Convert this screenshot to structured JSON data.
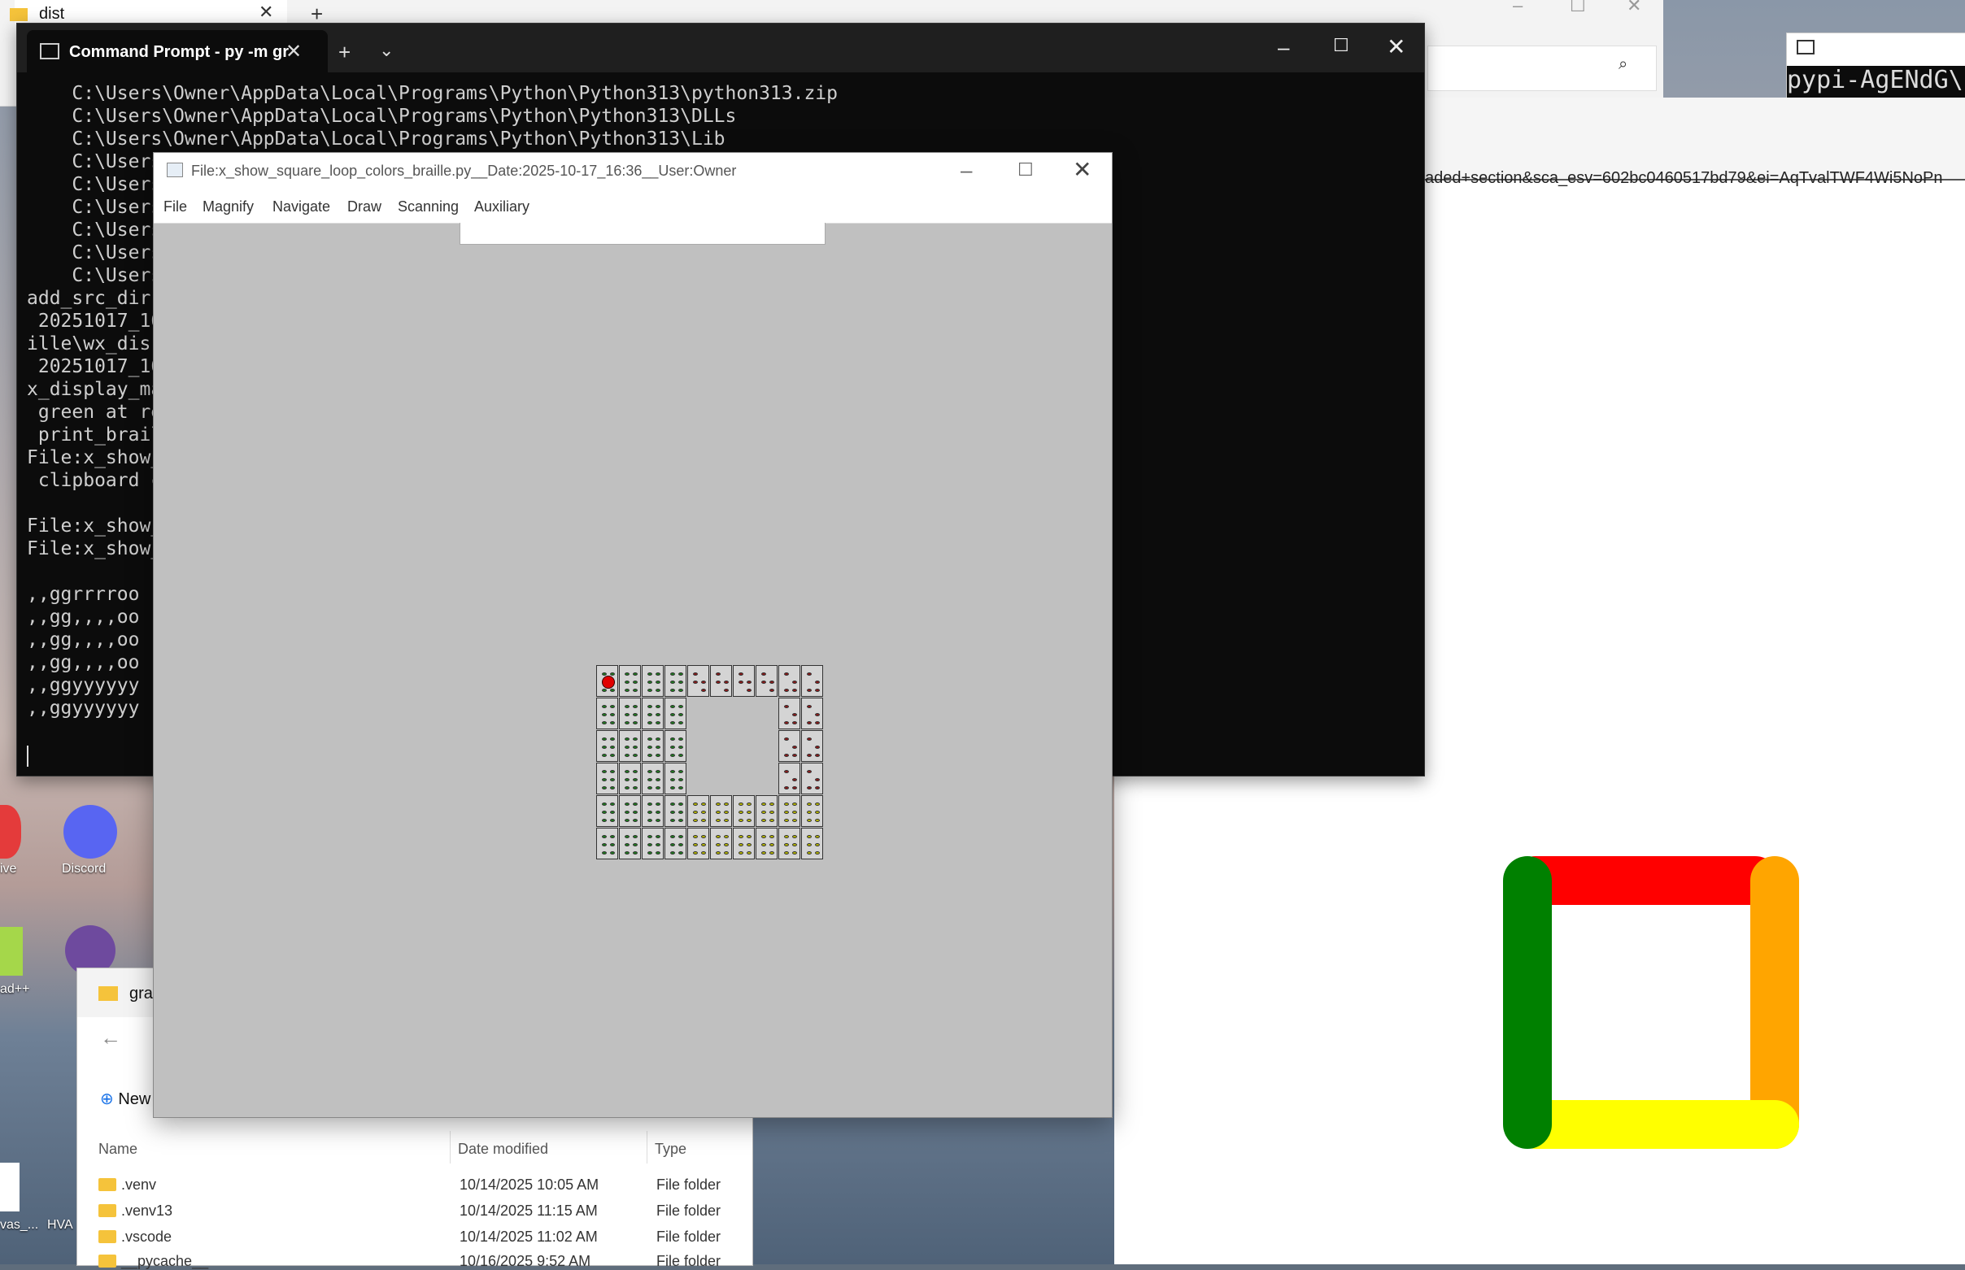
{
  "back_explorer": {
    "tab_title": "dist"
  },
  "right_terminal": {
    "text": "pypi-AgENdG\\"
  },
  "browser": {
    "url_fragment": "aded+section&sca_esv=602bc0460517bd79&ei=AqTvalTWF4Wi5NoPn"
  },
  "cmd": {
    "tab_title": "Command Prompt - py  -m gr",
    "lines": [
      "    C:\\Users\\Owner\\AppData\\Local\\Programs\\Python\\Python313\\python313.zip",
      "    C:\\Users\\Owner\\AppData\\Local\\Programs\\Python\\Python313\\DLLs",
      "    C:\\Users\\Owner\\AppData\\Local\\Programs\\Python\\Python313\\Lib",
      "    C:\\Users",
      "    C:\\Users",
      "    C:\\Users",
      "    C:\\Users",
      "    C:\\Users",
      "    C:\\Users",
      "add_src_dir",
      " 20251017_16",
      "ille\\wx_dis",
      " 20251017_16",
      "x_display_ma",
      " green at re",
      " print_brail",
      "File:x_show_",
      " clipboard c",
      "",
      "File:x_show_",
      "File:x_show_",
      "",
      ",,ggrrrroo",
      ",,gg,,,,oo",
      ",,gg,,,,oo",
      ",,gg,,,,oo",
      ",,ggyyyyyy",
      ",,ggyyyyyy"
    ]
  },
  "wx": {
    "title": "File:x_show_square_loop_colors_braille.py__Date:2025-10-17_16:36__User:Owner",
    "menu": [
      "File",
      "Magnify",
      "Navigate",
      "Draw",
      "Scanning",
      "Auxiliary"
    ]
  },
  "braille": {
    "rows": [
      ",,ggrrrroo",
      ",,gg,,,,oo",
      ",,gg,,,,oo",
      ",,gg,,,,oo",
      ",,ggyyyyyy",
      ",,ggyyyyyy"
    ],
    "colors": {
      "g": "#1f7a1f",
      "r": "#8b1a1a",
      "o": "#8b1a1a",
      "y": "#b5b500"
    }
  },
  "explorer": {
    "tab_title": "grap",
    "new_label": "New",
    "columns": [
      "Name",
      "Date modified",
      "Type"
    ],
    "rows": [
      {
        "name": ".venv",
        "date": "10/14/2025 10:05 AM",
        "type": "File folder"
      },
      {
        "name": ".venv13",
        "date": "10/14/2025 11:15 AM",
        "type": "File folder"
      },
      {
        "name": ".vscode",
        "date": "10/14/2025 11:02 AM",
        "type": "File folder"
      },
      {
        "name": "__pycache__",
        "date": "10/16/2025 9:52 AM",
        "type": "File folder"
      }
    ]
  },
  "desktop_icons": [
    {
      "label": "Discord",
      "icon": "discord-icon"
    },
    {
      "label": "ive",
      "icon": "app-icon"
    },
    {
      "label": "ad++",
      "icon": "notepad-icon"
    },
    {
      "label": "vas_...",
      "icon": "file-icon"
    },
    {
      "label": "HVA",
      "icon": "file-icon"
    }
  ],
  "loop_colors": {
    "top": "#ff0000",
    "right": "#ffa500",
    "bottom": "#ffff00",
    "left": "#008000"
  }
}
